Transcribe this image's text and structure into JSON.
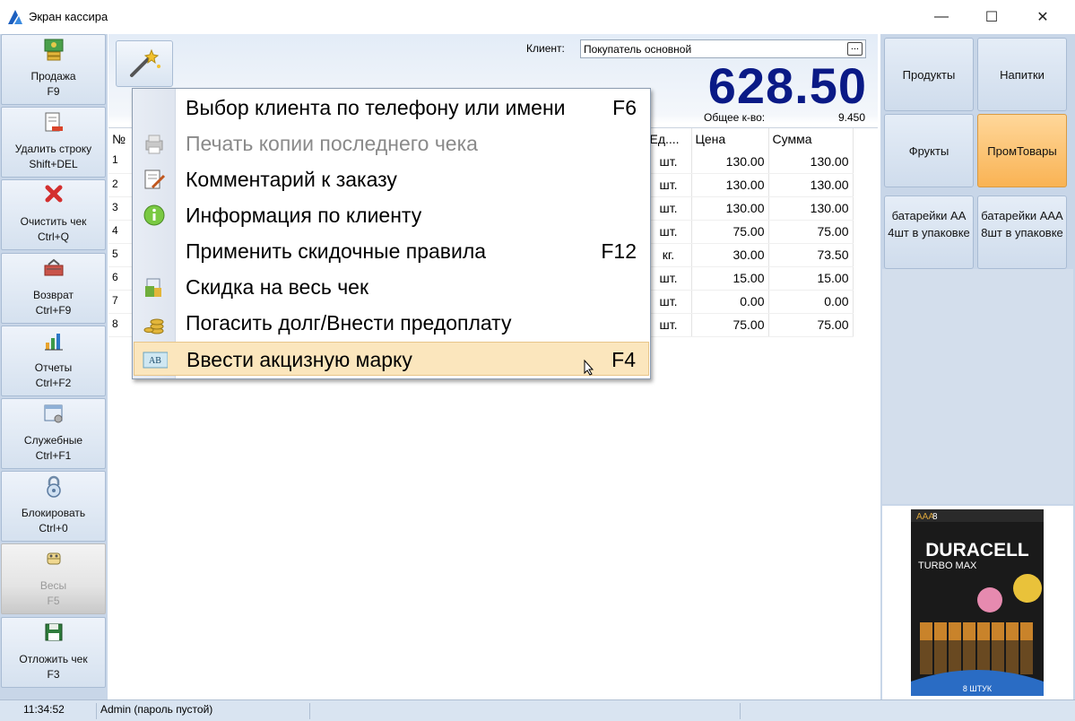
{
  "window": {
    "title": "Экран кассира",
    "minimize": "—",
    "maximize": "☐",
    "close": "✕"
  },
  "sidebar": {
    "items": [
      {
        "label": "Продажа\nF9",
        "icon": "cash-icon"
      },
      {
        "label": "Удалить строку\nShift+DEL",
        "icon": "delete-row-icon"
      },
      {
        "label": "Очистить чек\nCtrl+Q",
        "icon": "clear-icon"
      },
      {
        "label": "Возврат\nCtrl+F9",
        "icon": "return-icon"
      },
      {
        "label": "Отчеты\nCtrl+F2",
        "icon": "chart-icon"
      },
      {
        "label": "Служебные\nCtrl+F1",
        "icon": "service-icon"
      },
      {
        "label": "Блокировать\nCtrl+0",
        "icon": "lock-icon"
      },
      {
        "label": "Весы\nF5",
        "icon": "scales-icon",
        "disabled": true
      },
      {
        "label": "Отложить чек\nF3",
        "icon": "save-icon"
      }
    ]
  },
  "client": {
    "label": "Клиент:",
    "value": "Покупатель основной",
    "browse": "..."
  },
  "total": {
    "amount": "628.50",
    "qty_label": "Общее к-во:",
    "qty_value": "9.450"
  },
  "grid": {
    "headers": {
      "no": "№",
      "unit": "Ед....",
      "price": "Цена",
      "sum": "Сумма"
    },
    "rows": [
      {
        "no": "1",
        "unit": "шт.",
        "price": "130.00",
        "sum": "130.00"
      },
      {
        "no": "2",
        "unit": "шт.",
        "price": "130.00",
        "sum": "130.00"
      },
      {
        "no": "3",
        "unit": "шт.",
        "price": "130.00",
        "sum": "130.00"
      },
      {
        "no": "4",
        "unit": "шт.",
        "price": "75.00",
        "sum": "75.00"
      },
      {
        "no": "5",
        "unit": "кг.",
        "price": "30.00",
        "sum": "73.50"
      },
      {
        "no": "6",
        "unit": "шт.",
        "price": "15.00",
        "sum": "15.00"
      },
      {
        "no": "7",
        "unit": "шт.",
        "price": "0.00",
        "sum": "0.00"
      },
      {
        "no": "8",
        "unit": "шт.",
        "price": "75.00",
        "sum": "75.00"
      }
    ]
  },
  "categories": [
    {
      "label": "Продукты"
    },
    {
      "label": "Напитки"
    },
    {
      "label": "Фрукты"
    },
    {
      "label": "ПромТовары",
      "active": true
    }
  ],
  "products": [
    {
      "label": "батарейки АА 4шт в упаковке"
    },
    {
      "label": "батарейки ААА 8шт в упаковке"
    }
  ],
  "product_image": {
    "brand": "DURACELL",
    "subtitle": "TURBO MAX",
    "size": "AAA",
    "count_badge": "8",
    "pack": "8 ШТУК"
  },
  "menu": {
    "items": [
      {
        "label": "Выбор клиента по телефону или имени",
        "key": "F6",
        "icon": "none"
      },
      {
        "label": "Печать копии последнего чека",
        "key": "",
        "icon": "printer-icon",
        "disabled": true
      },
      {
        "label": "Комментарий к заказу",
        "key": "",
        "icon": "edit-note-icon"
      },
      {
        "label": "Информация по клиенту",
        "key": "",
        "icon": "info-icon"
      },
      {
        "label": "Применить скидочные правила",
        "key": "F12",
        "icon": "none"
      },
      {
        "label": "Скидка на весь чек",
        "key": "",
        "icon": "discount-icon"
      },
      {
        "label": "Погасить долг/Внести предоплату",
        "key": "",
        "icon": "coins-icon"
      },
      {
        "label": "Ввести акцизную марку",
        "key": "F4",
        "icon": "excise-stamp-icon",
        "highlight": true
      }
    ]
  },
  "status": {
    "time": "11:34:52",
    "user": "Admin (пароль пустой)"
  },
  "colors": {
    "total": "#0a1a86",
    "active_category": "#f9b354",
    "menu_highlight": "#fbe6bd",
    "panel_bg": "#c8d6e8"
  }
}
